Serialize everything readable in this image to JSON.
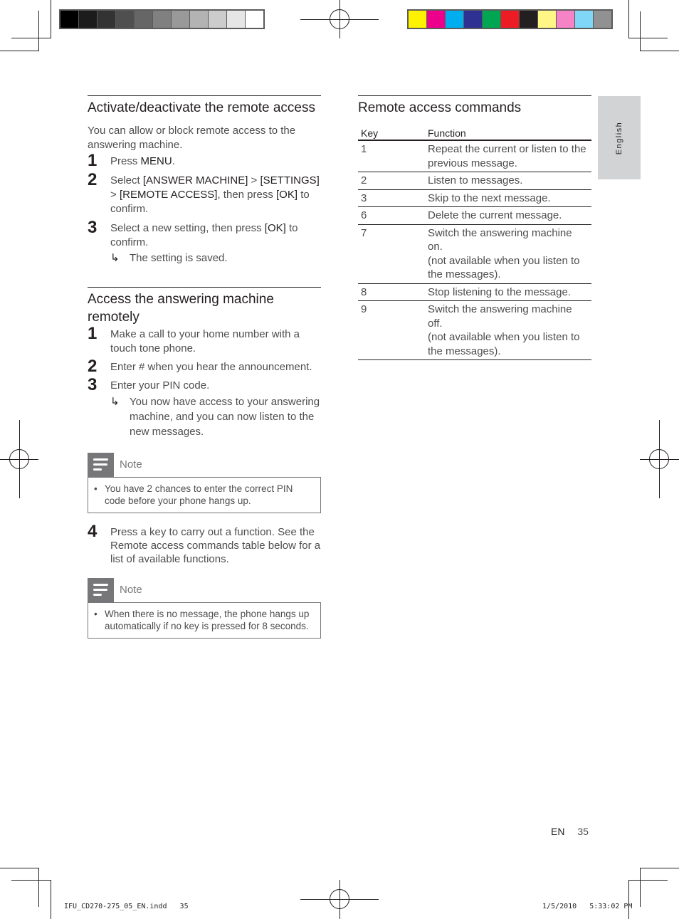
{
  "print_marks": {
    "grayscale_bar": [
      "#000000",
      "#1c1c1c",
      "#333333",
      "#4f4f4f",
      "#666666",
      "#808080",
      "#999999",
      "#b3b3b3",
      "#cccccc",
      "#e6e6e6",
      "#ffffff"
    ],
    "color_bar": [
      "#fff200",
      "#ec008c",
      "#00aeef",
      "#2e3192",
      "#00a651",
      "#ed1c24",
      "#231f20",
      "#fff685",
      "#f583c5",
      "#7fd6f7",
      "#919191"
    ]
  },
  "left_column": {
    "section1": {
      "title": "Activate/deactivate the remote access",
      "intro": "You can allow or block remote access to the answering machine.",
      "steps": [
        {
          "num": "1",
          "pre": "Press ",
          "b1": "MENU",
          "post": "."
        },
        {
          "num": "2",
          "pre": "Select ",
          "b1": "[ANSWER MACHINE]",
          "mid1": " > ",
          "b2": "[SETTINGS]",
          "mid2": " > ",
          "b3": "[REMOTE ACCESS]",
          "mid3": ", then press ",
          "b4": "[OK]",
          "post": " to confirm."
        },
        {
          "num": "3",
          "pre": "Select a new setting, then press ",
          "b1": "[OK]",
          "post": " to confirm.",
          "result": "The setting is saved."
        }
      ]
    },
    "section2": {
      "title": "Access the answering machine remotely",
      "steps": [
        {
          "num": "1",
          "text": "Make a call to your home number with a touch tone phone."
        },
        {
          "num": "2",
          "text": "Enter # when you hear the announcement."
        },
        {
          "num": "3",
          "text": "Enter your PIN code.",
          "result": "You now have access to your answering machine, and you can now listen to the new messages."
        }
      ],
      "note1": {
        "title": "Note",
        "bullet": "•",
        "text": "You have 2 chances to enter the correct PIN code before your phone hangs up."
      },
      "step4": {
        "num": "4",
        "text": "Press a key to carry out a function. See the Remote access commands table below for a list of available functions."
      },
      "note2": {
        "title": "Note",
        "bullet": "•",
        "text": "When there is no message, the phone hangs up automatically if no key is pressed for 8 seconds."
      }
    }
  },
  "right_column": {
    "title": "Remote access commands",
    "table": {
      "headers": [
        "Key",
        "Function"
      ],
      "rows": [
        {
          "key": "1",
          "function": "Repeat the current or listen to the previous message."
        },
        {
          "key": "2",
          "function": "Listen to messages."
        },
        {
          "key": "3",
          "function": "Skip to the next message."
        },
        {
          "key": "6",
          "function": "Delete the current message."
        },
        {
          "key": "7",
          "function": "Switch the answering machine on.",
          "note": "(not available when you listen to the messages)."
        },
        {
          "key": "8",
          "function": "Stop listening to the message."
        },
        {
          "key": "9",
          "function": "Switch the answering machine off.",
          "note": "(not available when you listen to the messages)."
        }
      ]
    }
  },
  "language_tab": "English",
  "footer": {
    "lang": "EN",
    "page": "35"
  },
  "slug": {
    "file": "IFU_CD270-275_05_EN.indd   35",
    "datetime": "1/5/2010   5:33:02 PM"
  },
  "glyphs": {
    "result_arrow": "↳"
  }
}
